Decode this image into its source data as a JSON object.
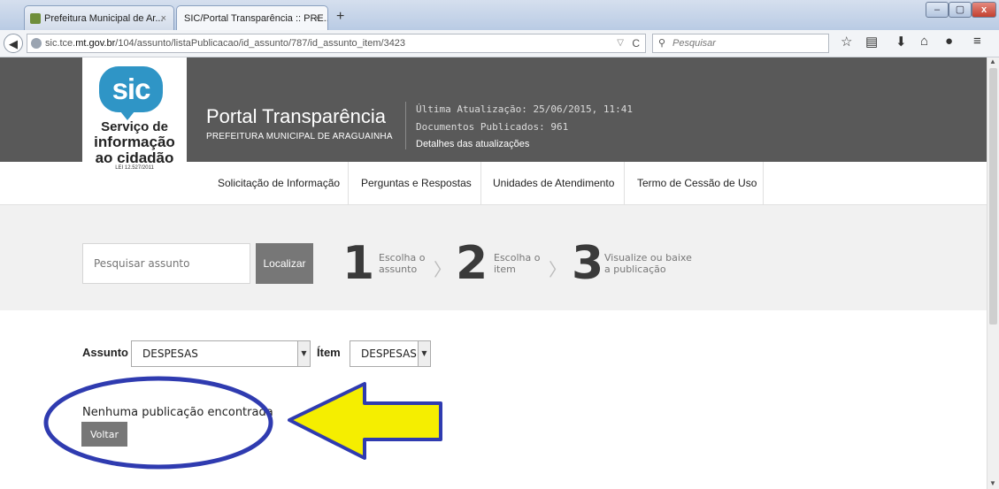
{
  "browser": {
    "tabs": [
      {
        "title": "Prefeitura Municipal de Ar...",
        "close": "×"
      },
      {
        "title": "SIC/Portal Transparência :: PRE...",
        "close": "×"
      }
    ],
    "new_tab": "+",
    "url_prefix": "sic.tce.",
    "url_host": "mt.gov.br",
    "url_path": "/104/assunto/listaPublicacao/id_assunto/787/id_assunto_item/3423",
    "search_placeholder": "Pesquisar",
    "window_buttons": {
      "minimize": "‒",
      "maximize": "▢",
      "close": "x"
    }
  },
  "logo": {
    "badge": "sic",
    "line1": "Serviço de",
    "line2": "informação",
    "line3": "ao cidadão",
    "law": "LEI 12.527/2011"
  },
  "header": {
    "title": "Portal Transparência",
    "subtitle": "PREFEITURA MUNICIPAL DE ARAGUAINHA",
    "last_update": "Última Atualização: 25/06/2015, 11:41",
    "docs_published": "Documentos Publicados: 961",
    "details_link": "Detalhes das atualizações"
  },
  "menu": {
    "items": [
      "Solicitação de Informação",
      "Perguntas e Respostas",
      "Unidades de Atendimento",
      "Termo de Cessão de Uso"
    ]
  },
  "search": {
    "placeholder": "Pesquisar assunto",
    "button": "Localizar"
  },
  "steps": [
    {
      "num": "1",
      "line1": "Escolha o",
      "line2": "assunto"
    },
    {
      "num": "2",
      "line1": "Escolha o",
      "line2": "item"
    },
    {
      "num": "3",
      "line1": "Visualize ou baixe",
      "line2": "a publicação"
    }
  ],
  "filters": {
    "assunto_label": "Assunto",
    "assunto_value": "DESPESAS",
    "item_label": "Ítem",
    "item_value": "DESPESAS"
  },
  "result": {
    "message": "Nenhuma publicação encontrada",
    "back_button": "Voltar"
  },
  "colors": {
    "header_dark": "#595959",
    "annotation_ring": "#2f3bb0",
    "annotation_arrow": "#f5ee00",
    "logo_blue": "#2f95c6"
  }
}
